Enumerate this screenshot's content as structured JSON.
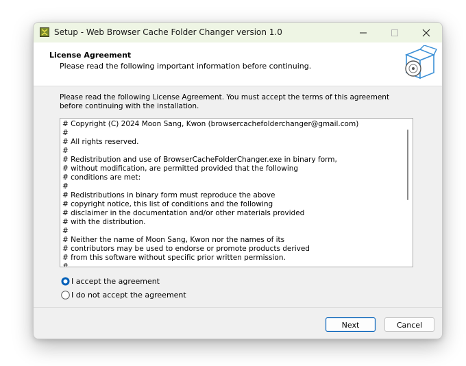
{
  "window": {
    "title": "Setup - Web Browser Cache Folder Changer version 1.0",
    "app_icon": "setup-app-icon",
    "controls": {
      "minimize": "minimize-icon",
      "maximize": "maximize-icon",
      "close": "close-icon"
    }
  },
  "header": {
    "title": "License Agreement",
    "subtitle": "Please read the following important information before continuing.",
    "icon": "software-box-icon"
  },
  "intro": {
    "text": "Please read the following License Agreement. You must accept the terms of this agreement before continuing with the installation."
  },
  "license": {
    "lines": [
      "# Copyright (C) 2024 Moon Sang, Kwon (browsercachefolderchanger@gmail.com)",
      "#",
      "# All rights reserved.",
      "#",
      "# Redistribution and use of BrowserCacheFolderChanger.exe in binary form,",
      "# without modification, are permitted provided that the following",
      "# conditions are met:",
      "#",
      "# Redistributions in binary form must reproduce the above",
      "# copyright notice, this list of conditions and the following",
      "# disclaimer in the documentation and/or other materials provided",
      "# with the distribution.",
      "#",
      "# Neither the name of Moon Sang, Kwon nor the names of its",
      "# contributors may be used to endorse or promote products derived",
      "# from this software without specific prior written permission.",
      "#"
    ]
  },
  "agreement": {
    "accept_label": "I accept the agreement",
    "decline_label": "I do not accept the agreement",
    "selected": "accept"
  },
  "buttons": {
    "next": "Next",
    "cancel": "Cancel"
  },
  "colors": {
    "accent": "#005fb8",
    "titlebar": "#eef5e4"
  }
}
